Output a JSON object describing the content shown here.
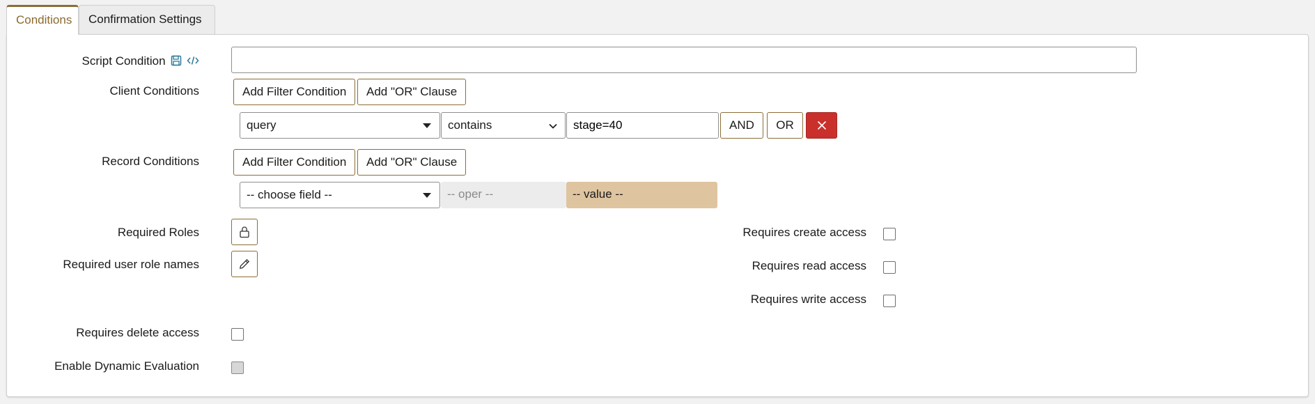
{
  "tabs": [
    {
      "label": "Conditions",
      "active": true
    },
    {
      "label": "Confirmation Settings",
      "active": false
    }
  ],
  "script_condition": {
    "label": "Script Condition",
    "value": "",
    "icons": [
      "save-icon",
      "code-icon"
    ]
  },
  "client_conditions": {
    "label": "Client Conditions",
    "add_filter_label": "Add Filter Condition",
    "add_or_label": "Add \"OR\" Clause",
    "row": {
      "field": "query",
      "operator": "contains",
      "value": "stage=40",
      "and_label": "AND",
      "or_label": "OR",
      "remove_icon": "close-icon"
    }
  },
  "record_conditions": {
    "label": "Record Conditions",
    "add_filter_label": "Add Filter Condition",
    "add_or_label": "Add \"OR\" Clause",
    "row": {
      "field_placeholder": "-- choose field --",
      "operator_placeholder": "-- oper --",
      "value_placeholder": "-- value --"
    }
  },
  "required_roles": {
    "label": "Required Roles",
    "icon": "lock-icon"
  },
  "required_user_role_names": {
    "label": "Required user role names",
    "icon": "pencil-icon"
  },
  "access": {
    "create": {
      "label": "Requires create access",
      "checked": false
    },
    "read": {
      "label": "Requires read access",
      "checked": false
    },
    "write": {
      "label": "Requires write access",
      "checked": false
    },
    "delete": {
      "label": "Requires delete access",
      "checked": false
    }
  },
  "dynamic_evaluation": {
    "label": "Enable Dynamic Evaluation",
    "checked": false,
    "disabled": true
  },
  "colors": {
    "accent": "#8b6d36",
    "danger": "#c9302c",
    "value_placeholder_bg": "#dfc4a0"
  }
}
